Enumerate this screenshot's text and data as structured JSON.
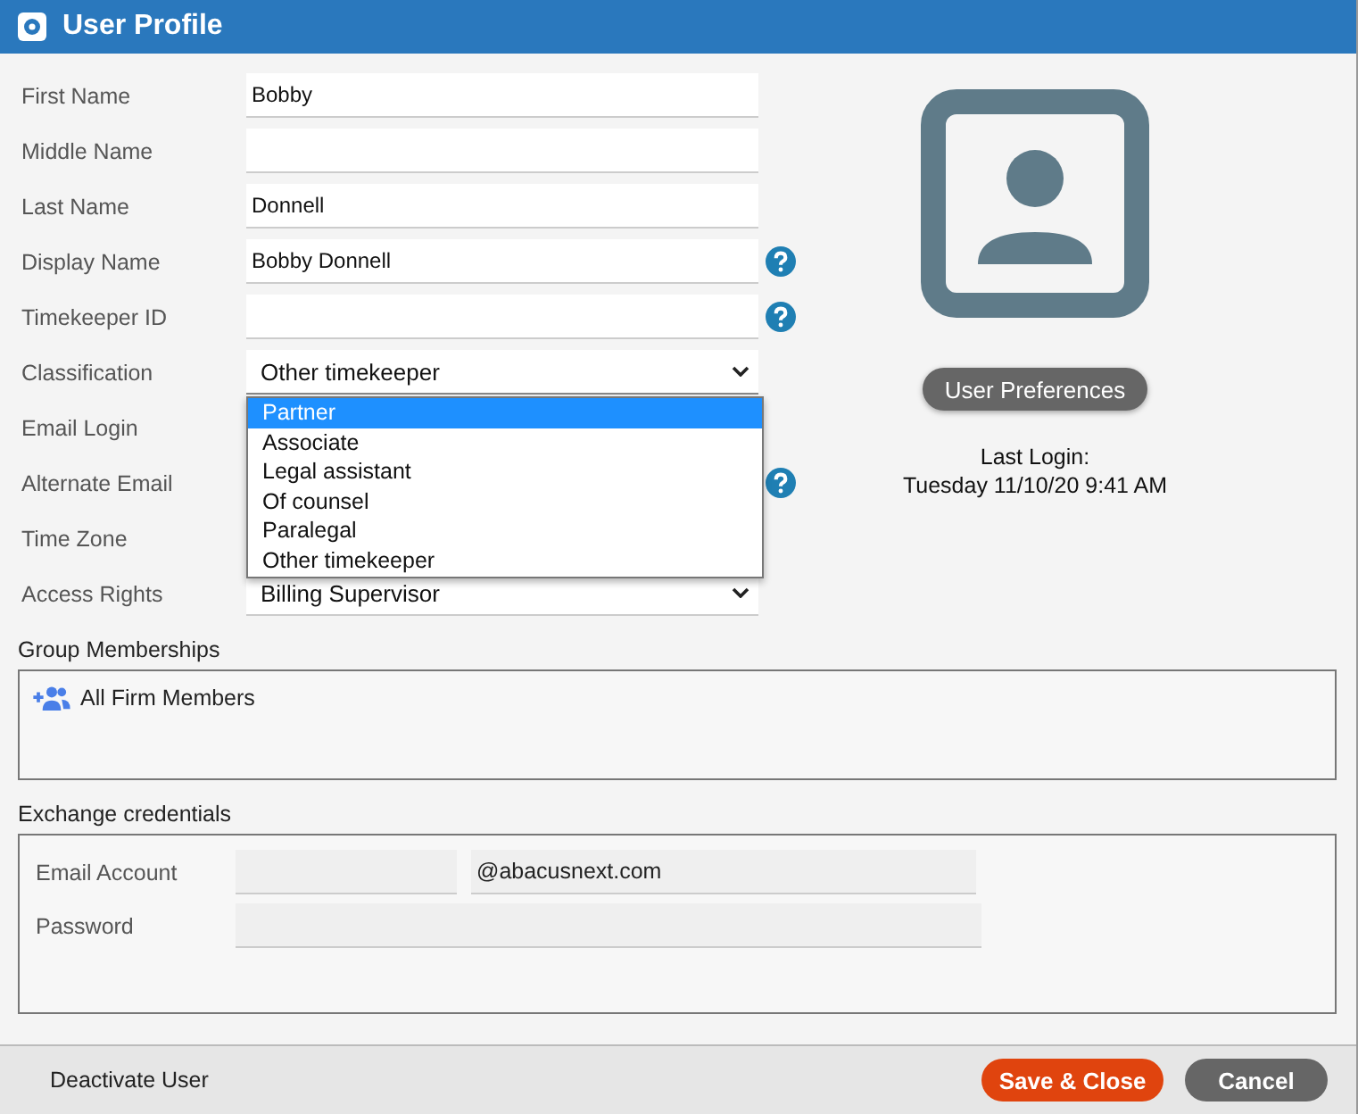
{
  "window": {
    "title": "User Profile"
  },
  "fields": [
    {
      "label": "First Name",
      "kind": "text",
      "value": "Bobby",
      "help": false
    },
    {
      "label": "Middle Name",
      "kind": "text",
      "help": false
    },
    {
      "label": "Last Name",
      "kind": "text",
      "value": "Donnell",
      "help": false
    },
    {
      "label": "Display Name",
      "kind": "text",
      "value": "Bobby Donnell",
      "help": true
    },
    {
      "label": "Timekeeper ID",
      "kind": "text",
      "help": true
    },
    {
      "label": "Classification",
      "kind": "select",
      "value": "Other timekeeper",
      "help": false,
      "expanded": true
    },
    {
      "label": "Email Login",
      "kind": "covered",
      "help": false
    },
    {
      "label": "Alternate Email",
      "kind": "covered",
      "help": true
    },
    {
      "label": "Time Zone",
      "kind": "covered",
      "help": false
    },
    {
      "label": "Access Rights",
      "kind": "select",
      "value": "Billing Supervisor",
      "help": false,
      "expanded": false
    }
  ],
  "dropdown_options": [
    {
      "label": "Partner",
      "selected": true
    },
    {
      "label": "Associate",
      "selected": false
    },
    {
      "label": "Legal assistant",
      "selected": false
    },
    {
      "label": "Of counsel",
      "selected": false
    },
    {
      "label": "Paralegal",
      "selected": false
    },
    {
      "label": "Other timekeeper",
      "selected": false
    }
  ],
  "preferences_button": "User Preferences",
  "last_login": {
    "label": "Last Login:",
    "value": "Tuesday 11/10/20 9:41 AM"
  },
  "group_memberships": {
    "title": "Group Memberships",
    "items": [
      "All Firm Members"
    ]
  },
  "exchange": {
    "title": "Exchange credentials",
    "email_label": "Email Account",
    "email_domain": "@abacusnext.com",
    "password_label": "Password"
  },
  "footer": {
    "deactivate": "Deactivate User",
    "save": "Save & Close",
    "cancel": "Cancel"
  }
}
